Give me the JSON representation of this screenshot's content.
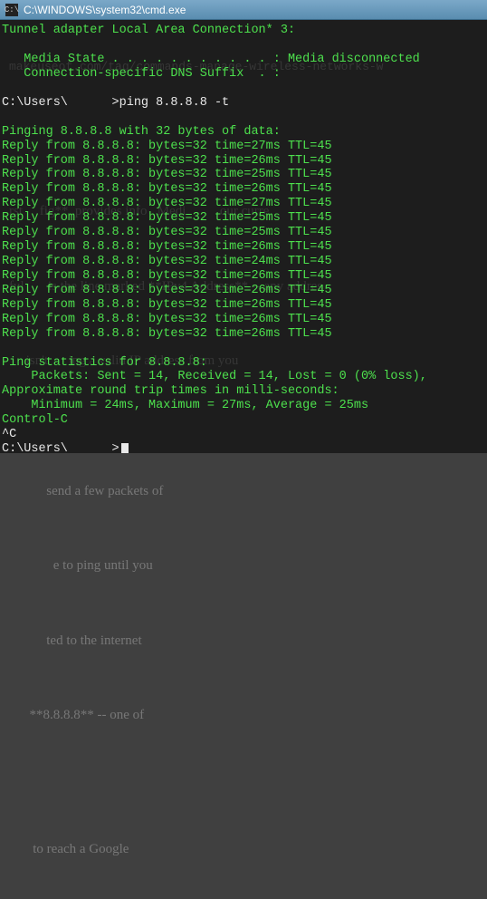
{
  "window": {
    "title": "C:\\WINDOWS\\system32\\cmd.exe",
    "icon": "cmd-icon"
  },
  "background": {
    "url_fragment": "makeuseof.com/tag/commands-manage-wireless-networks-w",
    "text_fragments": [
      "rst     fig**  provides info   Medi          our curre",
      "ful       is the line marked **IPv4 Address** -- any addres",
      "     isn't      ing a valid IP address from you",
      "",
      "           send a few packets of",
      "             e to ping until you",
      "           ted to the internet",
      "      **8.8.8.8** -- one of",
      "",
      "       to reach a Google"
    ]
  },
  "terminal": {
    "adapter_header": "Tunnel adapter Local Area Connection* 3:",
    "media_state_label": "   Media State . . . . . . . . . . . :",
    "media_state_value": " Media disconnected",
    "dns_label": "   Connection-specific DNS Suffix  . :",
    "prompt1": "C:\\Users\\      >",
    "ping_cmd": "ping 8.8.8.8 -t",
    "pinging_header": "Pinging 8.8.8.8 with 32 bytes of data:",
    "replies": [
      "Reply from 8.8.8.8: bytes=32 time=27ms TTL=45",
      "Reply from 8.8.8.8: bytes=32 time=26ms TTL=45",
      "Reply from 8.8.8.8: bytes=32 time=25ms TTL=45",
      "Reply from 8.8.8.8: bytes=32 time=26ms TTL=45",
      "Reply from 8.8.8.8: bytes=32 time=27ms TTL=45",
      "Reply from 8.8.8.8: bytes=32 time=25ms TTL=45",
      "Reply from 8.8.8.8: bytes=32 time=25ms TTL=45",
      "Reply from 8.8.8.8: bytes=32 time=26ms TTL=45",
      "Reply from 8.8.8.8: bytes=32 time=24ms TTL=45",
      "Reply from 8.8.8.8: bytes=32 time=26ms TTL=45",
      "Reply from 8.8.8.8: bytes=32 time=26ms TTL=45",
      "Reply from 8.8.8.8: bytes=32 time=26ms TTL=45",
      "Reply from 8.8.8.8: bytes=32 time=26ms TTL=45",
      "Reply from 8.8.8.8: bytes=32 time=26ms TTL=45"
    ],
    "stats_header": "Ping statistics for 8.8.8.8:",
    "stats_packets": "    Packets: Sent = 14, Received = 14, Lost = 0 (0% loss),",
    "stats_rtt_header": "Approximate round trip times in milli-seconds:",
    "stats_rtt": "    Minimum = 24ms, Maximum = 27ms, Average = 25ms",
    "ctrl_c": "Control-C",
    "caret_c": "^C",
    "prompt2": "C:\\Users\\      >"
  }
}
